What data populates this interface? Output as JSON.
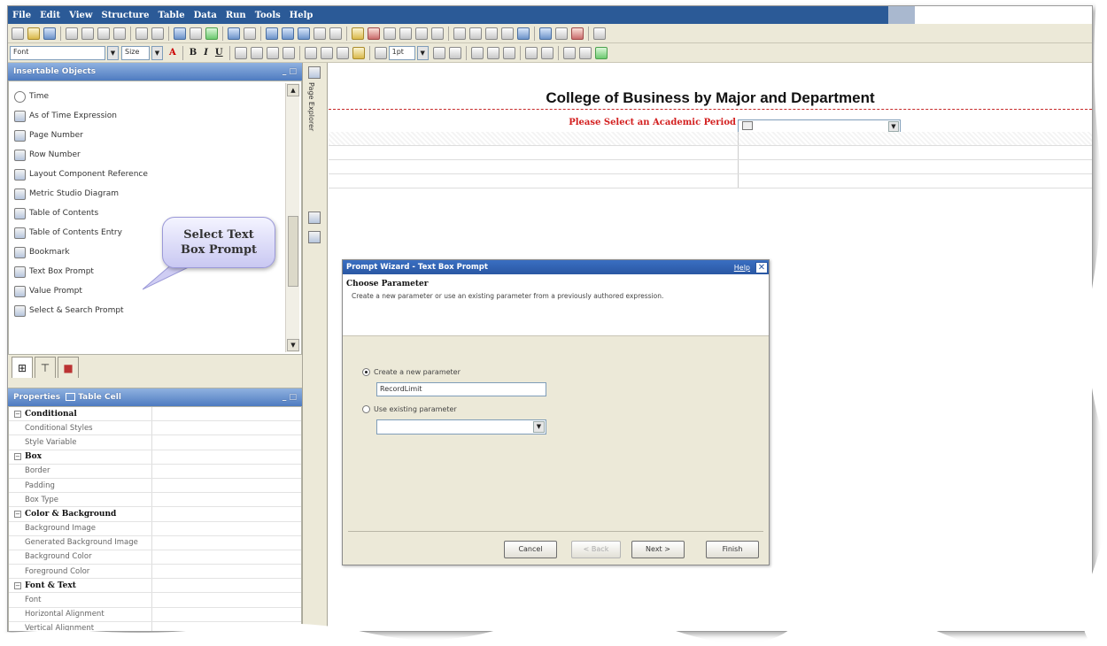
{
  "menu": [
    "File",
    "Edit",
    "View",
    "Structure",
    "Table",
    "Data",
    "Run",
    "Tools",
    "Help"
  ],
  "toolbar2": {
    "font": "Font",
    "size": "Size",
    "line": "1pt"
  },
  "insertable": {
    "header": "Insertable Objects",
    "items": [
      {
        "label": "Time",
        "icon": "clock-icon"
      },
      {
        "label": "As of Time Expression",
        "icon": "time-expression-icon"
      },
      {
        "label": "Page Number",
        "icon": "page-number-icon"
      },
      {
        "label": "Row Number",
        "icon": "row-number-icon"
      },
      {
        "label": "Layout Component Reference",
        "icon": "layout-reference-icon"
      },
      {
        "label": "Metric Studio Diagram",
        "icon": "metric-diagram-icon"
      },
      {
        "label": "Table of Contents",
        "icon": "toc-icon"
      },
      {
        "label": "Table of Contents Entry",
        "icon": "toc-entry-icon"
      },
      {
        "label": "Bookmark",
        "icon": "bookmark-icon"
      },
      {
        "label": "Text Box Prompt",
        "icon": "text-box-prompt-icon"
      },
      {
        "label": "Value Prompt",
        "icon": "value-prompt-icon"
      },
      {
        "label": "Select & Search Prompt",
        "icon": "select-search-prompt-icon"
      }
    ]
  },
  "properties": {
    "header": "Properties",
    "context": "Table Cell",
    "rows": [
      {
        "name": "Conditional",
        "group": true
      },
      {
        "name": "Conditional Styles"
      },
      {
        "name": "Style Variable"
      },
      {
        "name": "Box",
        "group": true
      },
      {
        "name": "Border"
      },
      {
        "name": "Padding"
      },
      {
        "name": "Box Type"
      },
      {
        "name": "Color & Background",
        "group": true
      },
      {
        "name": "Background Image"
      },
      {
        "name": "Generated Background Image"
      },
      {
        "name": "Background Color"
      },
      {
        "name": "Foreground Color"
      },
      {
        "name": "Font & Text",
        "group": true
      },
      {
        "name": "Font"
      },
      {
        "name": "Horizontal Alignment"
      },
      {
        "name": "Vertical Alignment"
      }
    ]
  },
  "page_explorer": {
    "label": "Page Explorer"
  },
  "report": {
    "title": "College of Business by Major and Department",
    "prompt_label": "Please Select an Academic Period"
  },
  "callout": {
    "line1": "Select Text",
    "line2": "Box Prompt"
  },
  "dialog": {
    "title": "Prompt Wizard - Text Box Prompt",
    "help": "Help",
    "heading": "Choose Parameter",
    "description": "Create a new parameter or use an existing parameter from a previously authored expression.",
    "option_new": "Create a new parameter",
    "new_param_value": "RecordLimit",
    "option_existing": "Use existing parameter",
    "selected_option": "new",
    "buttons": {
      "cancel": "Cancel",
      "back": "< Back",
      "next": "Next >",
      "finish": "Finish"
    }
  }
}
